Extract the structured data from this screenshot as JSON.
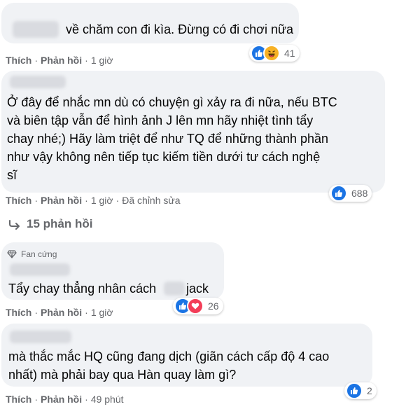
{
  "comments": [
    {
      "text_lines": [
        "về chăm con đi kìa. Đừng có đi chơi nữa"
      ],
      "actions": {
        "like": "Thích",
        "reply": "Phản hồi",
        "time": "1 giờ"
      },
      "reactions": {
        "icons": [
          "like-icon",
          "haha-icon"
        ],
        "count": "41"
      }
    },
    {
      "text_lines": [
        "Ở đây để nhắc mn dù có chuyện gì xảy ra đi nữa, nếu BTC",
        "và biên tập vẫn để hình ảnh J lên mn hãy nhiệt tình tẩy",
        "chay nhé;) Hãy làm triệt để như TQ để những thành phần",
        "như vậy không nên tiếp tục kiếm tiền dưới tư cách nghệ",
        "sĩ"
      ],
      "actions": {
        "like": "Thích",
        "reply": "Phản hồi",
        "time": "1 giờ",
        "edited": "Đã chỉnh sửa"
      },
      "reactions": {
        "icons": [
          "like-icon"
        ],
        "count": "688"
      },
      "replies_label": "15 phản hồi"
    },
    {
      "badge": "Fan cứng",
      "text_lines": [
        "Tẩy chay thẳng nhân cách",
        "jack"
      ],
      "actions": {
        "like": "Thích",
        "reply": "Phản hồi",
        "time": "1 giờ"
      },
      "reactions": {
        "icons": [
          "like-icon",
          "heart-icon"
        ],
        "count": "26"
      }
    },
    {
      "text_lines": [
        "mà thắc mắc HQ cũng đang dịch (giãn cách cấp độ 4 cao",
        "nhất) mà phải bay qua Hàn quay làm gì?"
      ],
      "actions": {
        "like": "Thích",
        "reply": "Phản hồi",
        "time": "49 phút"
      },
      "reactions": {
        "icons": [
          "like-icon"
        ],
        "count": "2"
      }
    }
  ],
  "colors": {
    "bubble": "#f0f2f5",
    "meta": "#65676b",
    "like": "#1b74e4",
    "haha": "#f7b125",
    "heart": "#f33e58"
  }
}
